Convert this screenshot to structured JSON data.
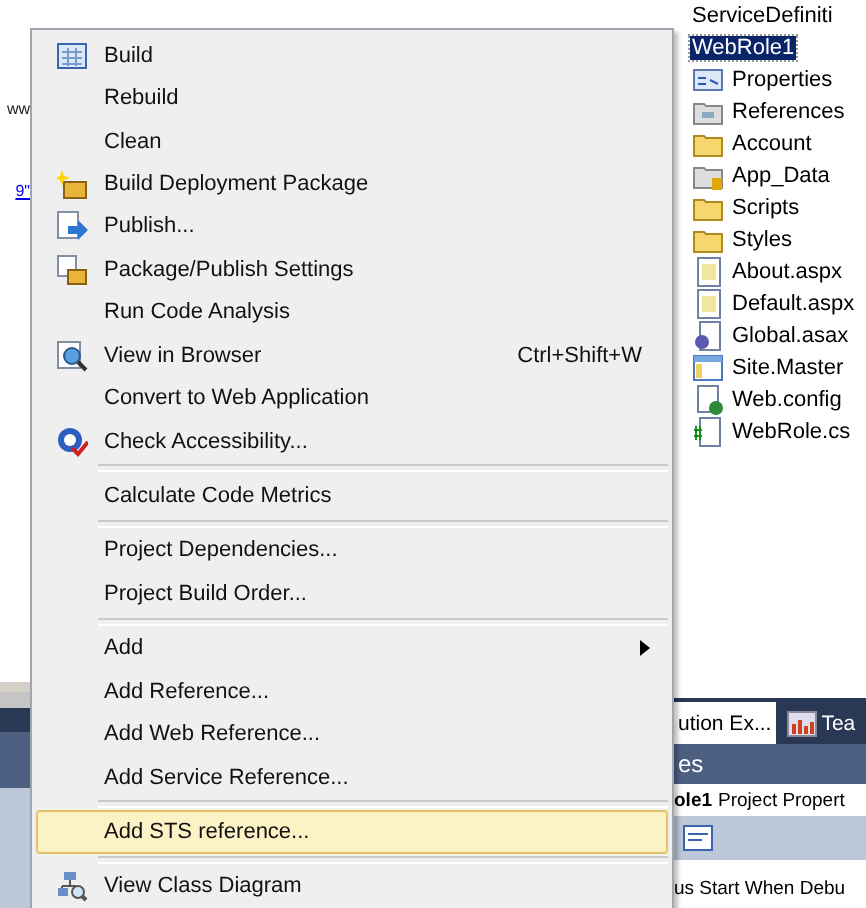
{
  "background_left": {
    "fragments": [
      {
        "kind": "text",
        "text": "ww"
      },
      {
        "kind": "link",
        "text": "9\""
      }
    ]
  },
  "context_menu": {
    "items": [
      {
        "kind": "item",
        "label": "Build",
        "selected": false
      },
      {
        "kind": "item",
        "label": "Rebuild",
        "selected": false
      },
      {
        "kind": "item",
        "label": "Clean",
        "selected": false
      },
      {
        "kind": "item",
        "label": "Build Deployment Package",
        "selected": false
      },
      {
        "kind": "item",
        "label": "Publish...",
        "selected": false
      },
      {
        "kind": "item",
        "label": "Package/Publish Settings",
        "selected": false
      },
      {
        "kind": "item",
        "label": "Run Code Analysis",
        "selected": false
      },
      {
        "kind": "item",
        "label": "View in Browser",
        "shortcut": "Ctrl+Shift+W",
        "selected": false
      },
      {
        "kind": "item",
        "label": "Convert to Web Application",
        "selected": false
      },
      {
        "kind": "item",
        "label": "Check Accessibility...",
        "selected": false
      },
      {
        "kind": "separator"
      },
      {
        "kind": "item",
        "label": "Calculate Code Metrics",
        "selected": false
      },
      {
        "kind": "separator"
      },
      {
        "kind": "item",
        "label": "Project Dependencies...",
        "selected": false
      },
      {
        "kind": "item",
        "label": "Project Build Order...",
        "selected": false
      },
      {
        "kind": "separator"
      },
      {
        "kind": "item",
        "label": "Add",
        "submenu": true,
        "selected": false
      },
      {
        "kind": "item",
        "label": "Add Reference...",
        "selected": false
      },
      {
        "kind": "item",
        "label": "Add Web Reference...",
        "selected": false
      },
      {
        "kind": "item",
        "label": "Add Service Reference...",
        "selected": false
      },
      {
        "kind": "separator"
      },
      {
        "kind": "item",
        "label": "Add STS reference...",
        "selected": true
      },
      {
        "kind": "separator"
      },
      {
        "kind": "item",
        "label": "View Class Diagram",
        "selected": false
      }
    ]
  },
  "solution_explorer": {
    "tree": [
      {
        "label": "ServiceDefiniti",
        "selected": false
      },
      {
        "label": "WebRole1",
        "selected": true,
        "children": [
          {
            "label": "Properties",
            "selected": false
          },
          {
            "label": "References",
            "selected": false
          },
          {
            "label": "Account",
            "selected": false
          },
          {
            "label": "App_Data",
            "selected": false
          },
          {
            "label": "Scripts",
            "selected": false
          },
          {
            "label": "Styles",
            "selected": false
          },
          {
            "label": "About.aspx",
            "selected": false
          },
          {
            "label": "Default.aspx",
            "selected": false
          },
          {
            "label": "Global.asax",
            "selected": false
          },
          {
            "label": "Site.Master",
            "selected": false
          },
          {
            "label": "Web.config",
            "selected": false
          },
          {
            "label": "WebRole.cs",
            "selected": false
          }
        ]
      }
    ],
    "tabs": [
      {
        "label": "ution Ex...",
        "selected": true
      },
      {
        "label": "Tea",
        "selected": false
      }
    ]
  },
  "properties_panel": {
    "header": "es",
    "title_bold": "ole1",
    "title": "Project Propert",
    "row": "us Start When Debu"
  }
}
